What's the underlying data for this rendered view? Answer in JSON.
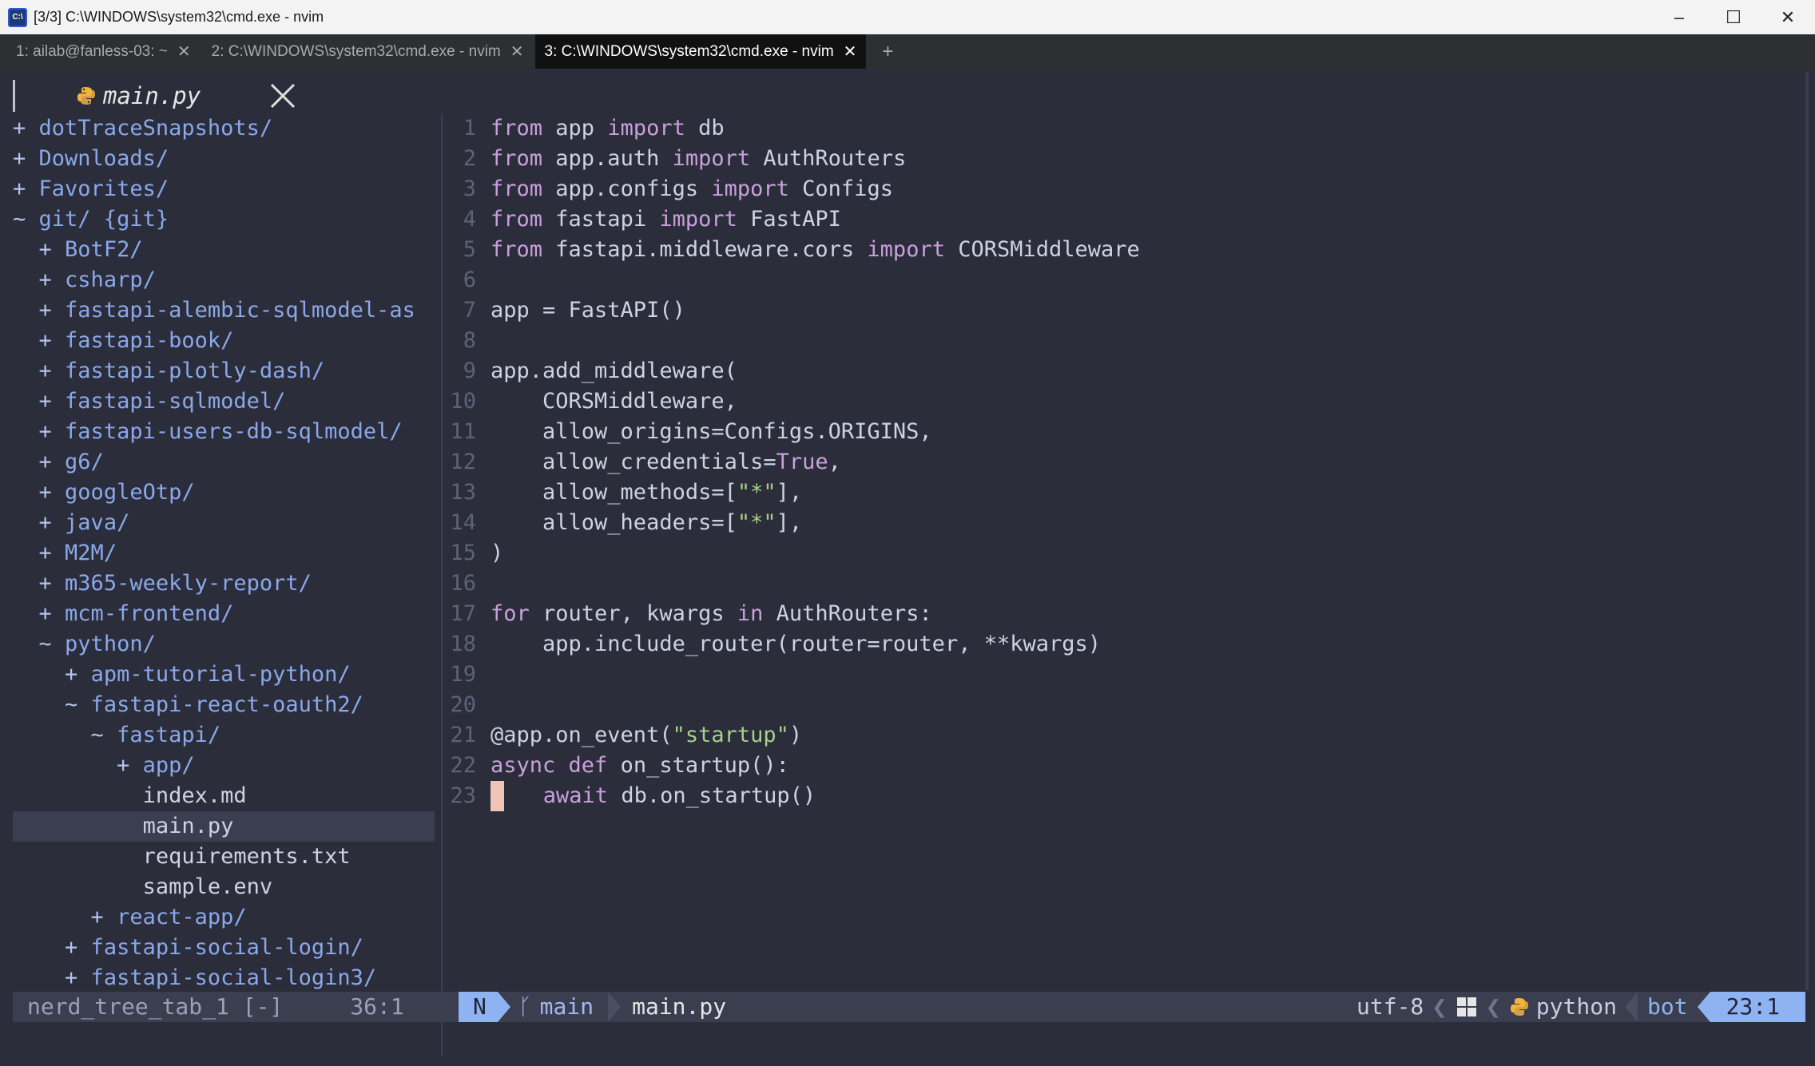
{
  "window": {
    "title": "[3/3] C:\\WINDOWS\\system32\\cmd.exe - nvim",
    "controls": [
      "–",
      "☐",
      "✕"
    ]
  },
  "tabs": [
    {
      "label": "1: ailab@fanless-03: ~",
      "active": false
    },
    {
      "label": "2: C:\\WINDOWS\\system32\\cmd.exe - nvim",
      "active": false
    },
    {
      "label": "3: C:\\WINDOWS\\system32\\cmd.exe - nvim",
      "active": true
    }
  ],
  "tab_add": "+",
  "editor_tab": {
    "title": "main.py"
  },
  "tree": [
    {
      "marker": "+",
      "text": "dotTraceSnapshots/",
      "indent": 0,
      "type": "dir"
    },
    {
      "marker": "+",
      "text": "Downloads/",
      "indent": 0,
      "type": "dir"
    },
    {
      "marker": "+",
      "text": "Favorites/",
      "indent": 0,
      "type": "dir"
    },
    {
      "marker": "~",
      "text": "git/ {git}",
      "indent": 0,
      "type": "dir"
    },
    {
      "marker": "+",
      "text": "BotF2/",
      "indent": 1,
      "type": "dir"
    },
    {
      "marker": "+",
      "text": "csharp/",
      "indent": 1,
      "type": "dir"
    },
    {
      "marker": "+",
      "text": "fastapi-alembic-sqlmodel-as",
      "indent": 1,
      "type": "dir"
    },
    {
      "marker": "+",
      "text": "fastapi-book/",
      "indent": 1,
      "type": "dir"
    },
    {
      "marker": "+",
      "text": "fastapi-plotly-dash/",
      "indent": 1,
      "type": "dir"
    },
    {
      "marker": "+",
      "text": "fastapi-sqlmodel/",
      "indent": 1,
      "type": "dir"
    },
    {
      "marker": "+",
      "text": "fastapi-users-db-sqlmodel/",
      "indent": 1,
      "type": "dir"
    },
    {
      "marker": "+",
      "text": "g6/",
      "indent": 1,
      "type": "dir"
    },
    {
      "marker": "+",
      "text": "googleOtp/",
      "indent": 1,
      "type": "dir"
    },
    {
      "marker": "+",
      "text": "java/",
      "indent": 1,
      "type": "dir"
    },
    {
      "marker": "+",
      "text": "M2M/",
      "indent": 1,
      "type": "dir"
    },
    {
      "marker": "+",
      "text": "m365-weekly-report/",
      "indent": 1,
      "type": "dir"
    },
    {
      "marker": "+",
      "text": "mcm-frontend/",
      "indent": 1,
      "type": "dir"
    },
    {
      "marker": "~",
      "text": "python/",
      "indent": 1,
      "type": "dir"
    },
    {
      "marker": "+",
      "text": "apm-tutorial-python/",
      "indent": 2,
      "type": "dir"
    },
    {
      "marker": "~",
      "text": "fastapi-react-oauth2/",
      "indent": 2,
      "type": "dir"
    },
    {
      "marker": "~",
      "text": "fastapi/",
      "indent": 3,
      "type": "dir"
    },
    {
      "marker": "+",
      "text": "app/",
      "indent": 4,
      "type": "dir"
    },
    {
      "marker": "",
      "text": "index.md",
      "indent": 4,
      "type": "file"
    },
    {
      "marker": "",
      "text": "main.py",
      "indent": 4,
      "type": "file",
      "selected": true
    },
    {
      "marker": "",
      "text": "requirements.txt",
      "indent": 4,
      "type": "file"
    },
    {
      "marker": "",
      "text": "sample.env",
      "indent": 4,
      "type": "file"
    },
    {
      "marker": "+",
      "text": "react-app/",
      "indent": 3,
      "type": "dir"
    },
    {
      "marker": "+",
      "text": "fastapi-social-login/",
      "indent": 2,
      "type": "dir"
    },
    {
      "marker": "+",
      "text": "fastapi-social-login3/",
      "indent": 2,
      "type": "dir"
    }
  ],
  "code": [
    [
      {
        "t": "from",
        "c": "kw"
      },
      {
        "t": " app "
      },
      {
        "t": "import",
        "c": "kw"
      },
      {
        "t": " db"
      }
    ],
    [
      {
        "t": "from",
        "c": "kw"
      },
      {
        "t": " app.auth "
      },
      {
        "t": "import",
        "c": "kw"
      },
      {
        "t": " AuthRouters"
      }
    ],
    [
      {
        "t": "from",
        "c": "kw"
      },
      {
        "t": " app.configs "
      },
      {
        "t": "import",
        "c": "kw"
      },
      {
        "t": " Configs"
      }
    ],
    [
      {
        "t": "from",
        "c": "kw"
      },
      {
        "t": " fastapi "
      },
      {
        "t": "import",
        "c": "kw"
      },
      {
        "t": " FastAPI"
      }
    ],
    [
      {
        "t": "from",
        "c": "kw"
      },
      {
        "t": " fastapi.middleware.cors "
      },
      {
        "t": "import",
        "c": "kw"
      },
      {
        "t": " CORSMiddleware"
      }
    ],
    [],
    [
      {
        "t": "app = FastAPI()"
      }
    ],
    [],
    [
      {
        "t": "app.add_middleware("
      }
    ],
    [
      {
        "t": "    CORSMiddleware,"
      }
    ],
    [
      {
        "t": "    allow_origins=Configs.ORIGINS,"
      }
    ],
    [
      {
        "t": "    allow_credentials="
      },
      {
        "t": "True",
        "c": "tr"
      },
      {
        "t": ","
      }
    ],
    [
      {
        "t": "    allow_methods=["
      },
      {
        "t": "\"*\"",
        "c": "str"
      },
      {
        "t": "],"
      }
    ],
    [
      {
        "t": "    allow_headers=["
      },
      {
        "t": "\"*\"",
        "c": "str"
      },
      {
        "t": "],"
      }
    ],
    [
      {
        "t": ")"
      }
    ],
    [],
    [
      {
        "t": "for",
        "c": "kw"
      },
      {
        "t": " router, kwargs "
      },
      {
        "t": "in",
        "c": "kw"
      },
      {
        "t": " AuthRouters:"
      }
    ],
    [
      {
        "t": "    app.include_router(router=router, **kwargs)"
      }
    ],
    [],
    [],
    [
      {
        "t": "@app.on_event("
      },
      {
        "t": "\"startup\"",
        "c": "str"
      },
      {
        "t": ")"
      }
    ],
    [
      {
        "t": "async",
        "c": "kw"
      },
      {
        "t": " "
      },
      {
        "t": "def",
        "c": "kw"
      },
      {
        "t": " on_startup():"
      }
    ],
    [
      {
        "t": " ",
        "c": "cur"
      },
      {
        "t": "   "
      },
      {
        "t": "await",
        "c": "kw"
      },
      {
        "t": " db.on_startup()"
      }
    ]
  ],
  "status": {
    "tree_name": "nerd_tree_tab_1 [-]",
    "tree_pos": "36:1",
    "mode": "N",
    "branch": "main",
    "file": "main.py",
    "encoding": "utf-8",
    "filetype": "python",
    "position_label": "bot",
    "cursor": "23:1"
  }
}
